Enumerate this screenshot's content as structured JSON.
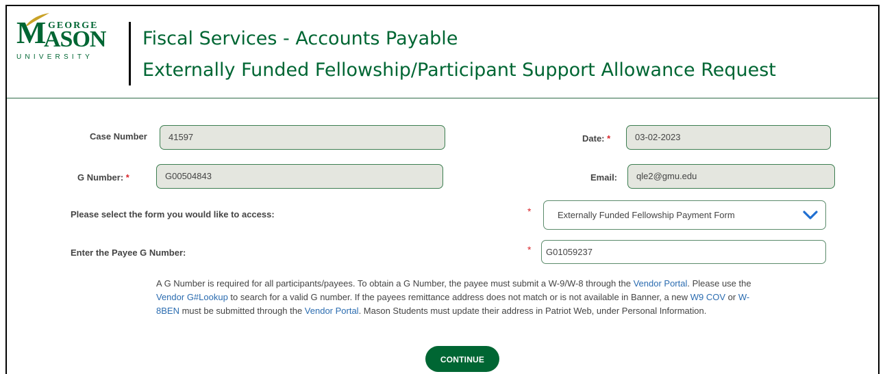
{
  "logo": {
    "george": "GEORGE",
    "m": "M",
    "ason": "ASON",
    "university": "UNIVERSITY"
  },
  "header": {
    "title_line1": "Fiscal Services - Accounts Payable",
    "title_line2": "Externally Funded Fellowship/Participant Support Allowance Request"
  },
  "form": {
    "case_number": {
      "label": "Case Number",
      "value": "41597"
    },
    "date": {
      "label": "Date:",
      "required_mark": "*",
      "value": "03-02-2023"
    },
    "g_number": {
      "label": "G Number:",
      "required_mark": "*",
      "value": "G00504843"
    },
    "email": {
      "label": "Email:",
      "value": "qle2@gmu.edu"
    },
    "form_select": {
      "label": "Please select the form you would like to access:",
      "required_mark": "*",
      "value": "Externally Funded Fellowship Payment Form"
    },
    "payee_g_number": {
      "label": "Enter the Payee G Number:",
      "required_mark": "*",
      "value": "G01059237"
    }
  },
  "help": {
    "t1": "A G Number is required for all participants/payees. To obtain a G Number, the payee must submit a W-9/W-8 through the ",
    "link_vendor_portal": "Vendor Portal",
    "t2": ". Please use the ",
    "link_lookup": "Vendor G#Lookup",
    "t3": " to search for a valid G number. If the payees remittance address does not match or is not available in Banner, a new ",
    "link_w9": "W9 COV",
    "t4": " or ",
    "link_w8": "W-8BEN",
    "t5": " must be submitted through the ",
    "link_vendor_portal2": "Vendor Portal",
    "t6": ". Mason Students must update their address in Patriot Web, under Personal Information."
  },
  "continue_button": "CONTINUE",
  "colors": {
    "brand_green": "#006633",
    "required_red": "#d9262c",
    "link_blue": "#2b6cb0",
    "field_bg": "#e4e6df"
  },
  "icons": {
    "select_arrow": "chevron-down-icon"
  }
}
